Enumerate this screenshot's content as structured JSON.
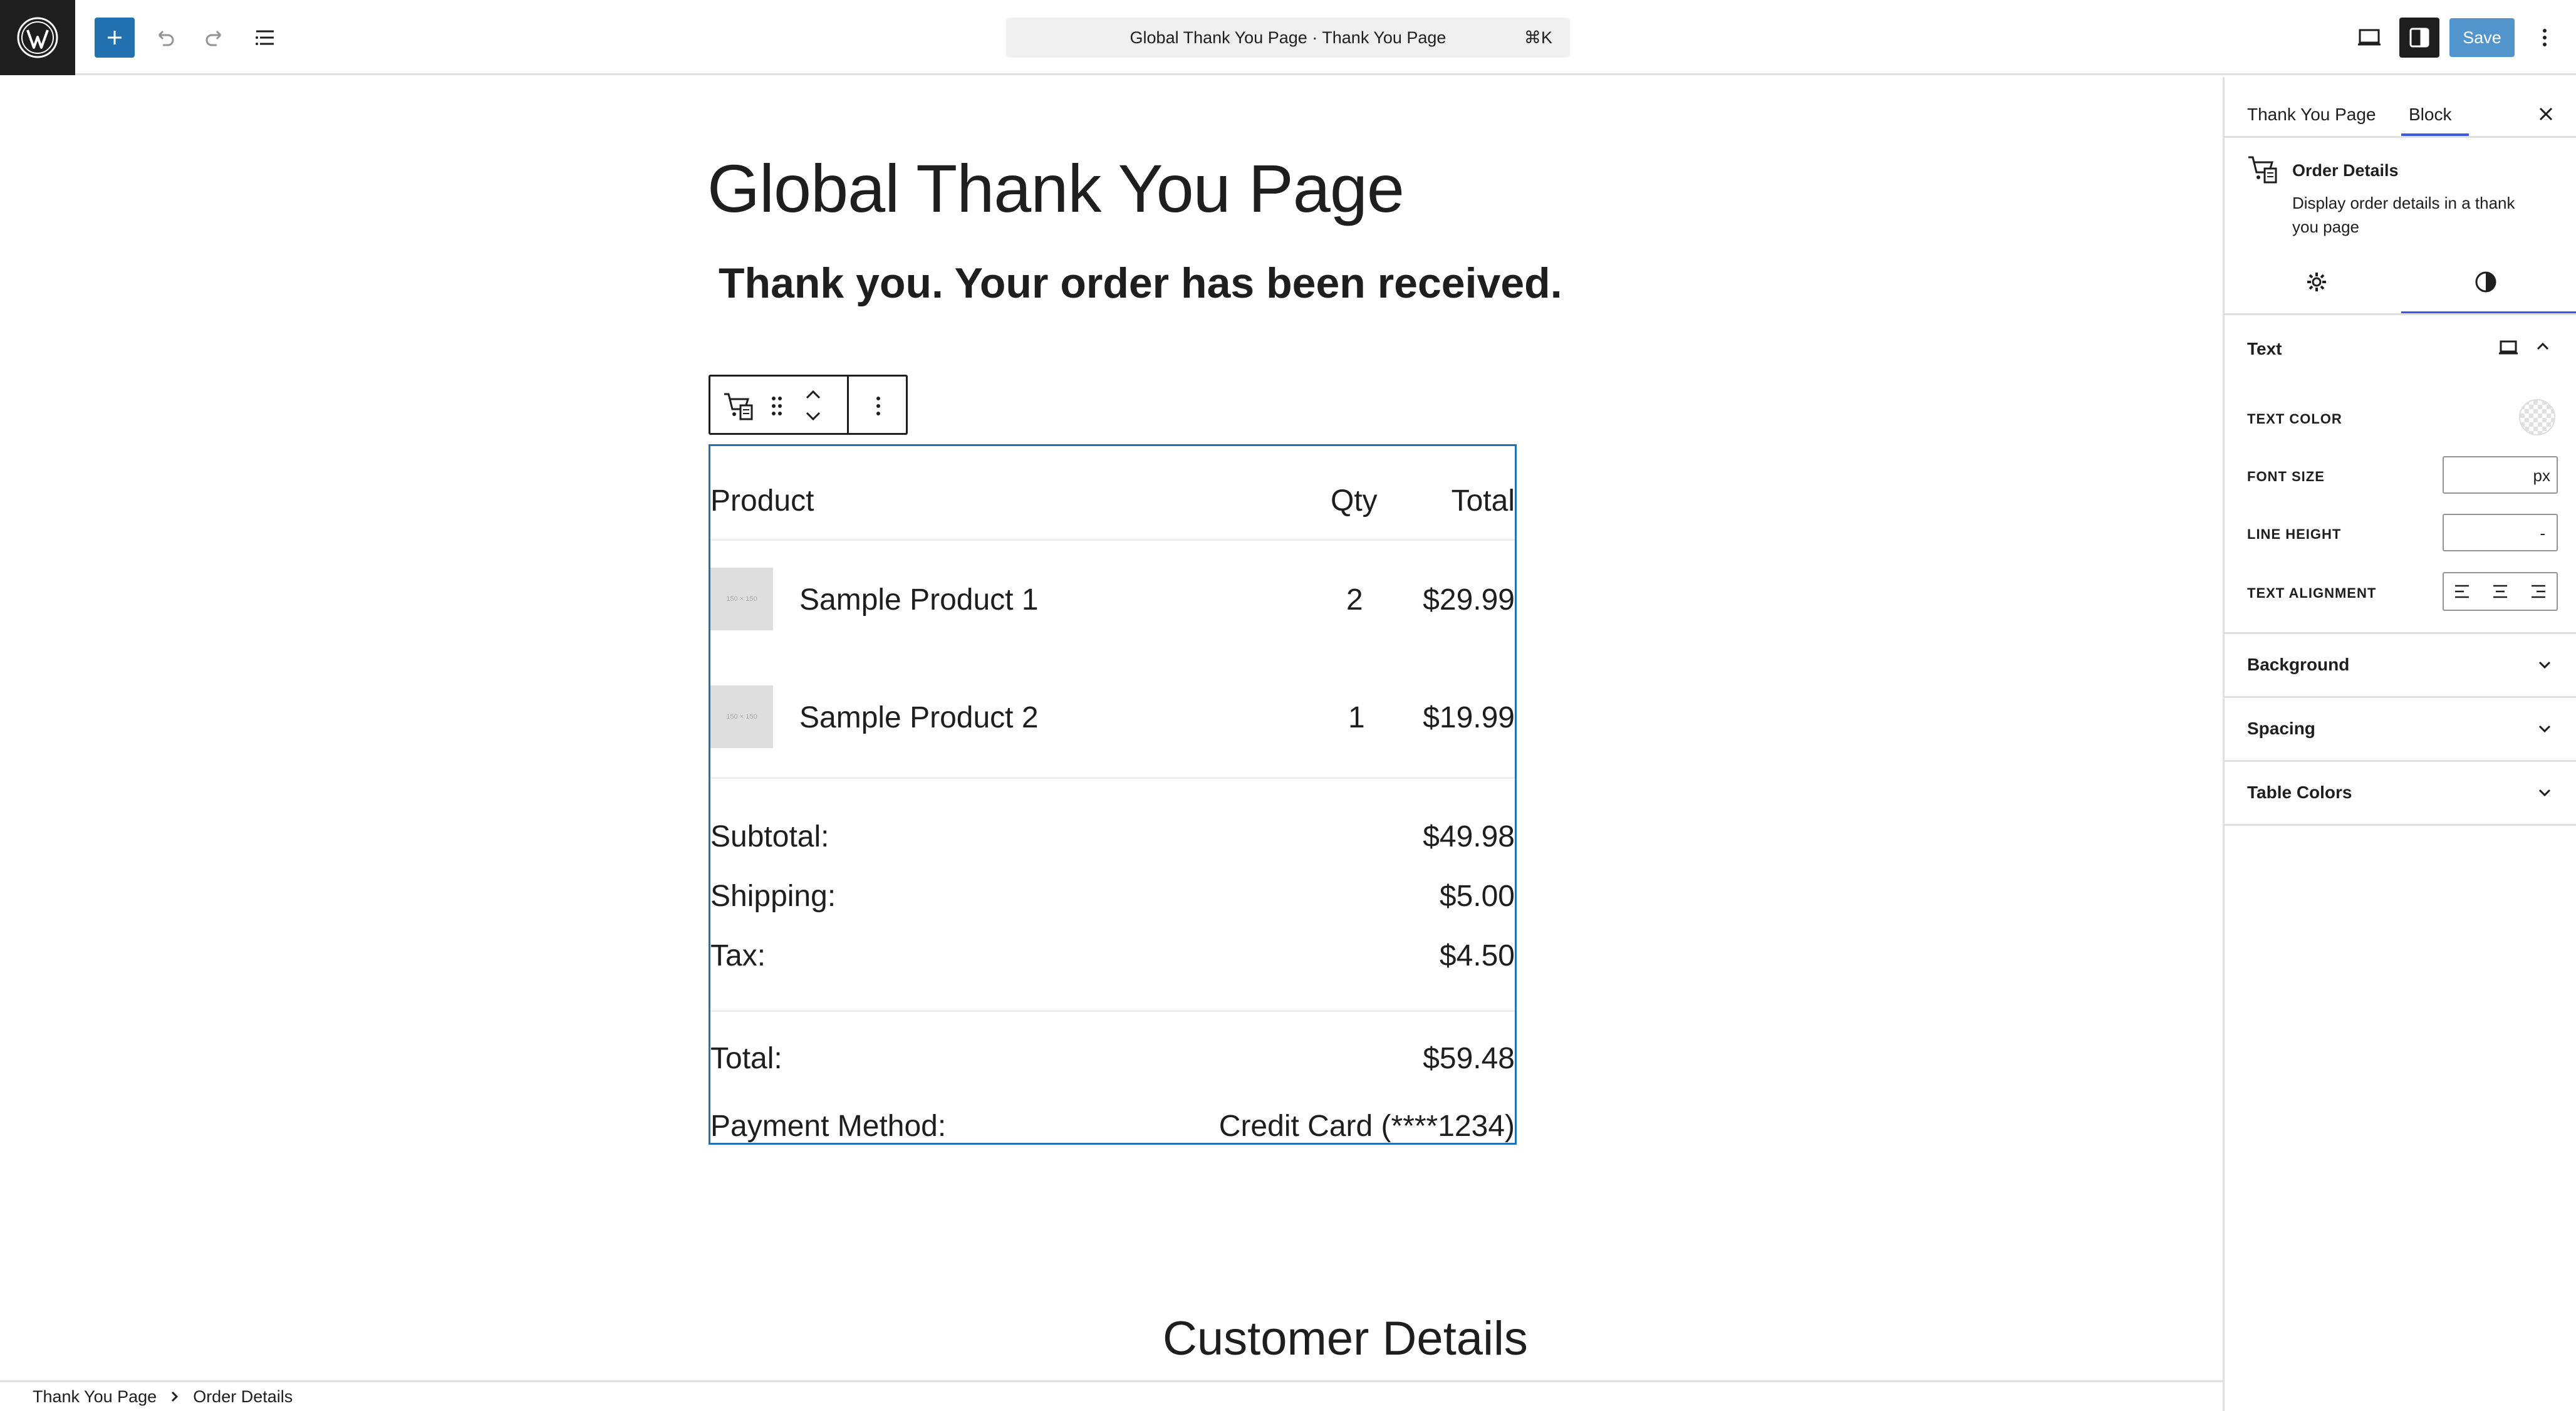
{
  "topbar": {
    "document_title": "Global Thank You Page · Thank You Page",
    "shortcut": "⌘K",
    "save_label": "Save",
    "icons": [
      "wordpress-logo-icon",
      "plus-icon",
      "undo-icon",
      "redo-icon",
      "list-view-icon",
      "desktop-preview-icon",
      "settings-panel-icon",
      "more-options-icon"
    ]
  },
  "canvas": {
    "page_title": "Global Thank You Page",
    "thanks_message": "Thank you. Your order has been received.",
    "order_table": {
      "headers": {
        "product": "Product",
        "qty": "Qty",
        "total": "Total"
      },
      "items": [
        {
          "thumb": "150 × 150",
          "name": "Sample Product 1",
          "qty": "2",
          "total": "$29.99"
        },
        {
          "thumb": "150 × 150",
          "name": "Sample Product 2",
          "qty": "1",
          "total": "$19.99"
        }
      ],
      "subtotal": {
        "label": "Subtotal:",
        "value": "$49.98"
      },
      "shipping": {
        "label": "Shipping:",
        "value": "$5.00"
      },
      "tax": {
        "label": "Tax:",
        "value": "$4.50"
      },
      "total": {
        "label": "Total:",
        "value": "$59.48"
      },
      "payment": {
        "label": "Payment Method:",
        "value": "Credit Card (****1234)"
      }
    },
    "customer_details_heading": "Customer Details"
  },
  "footer": {
    "breadcrumb": [
      "Thank You Page",
      "Order Details"
    ]
  },
  "sidebar": {
    "tabs": [
      {
        "label": "Thank You Page"
      },
      {
        "label": "Block"
      }
    ],
    "active_tab": "Block",
    "block": {
      "title": "Order Details",
      "description": "Display order details in a thank you page"
    },
    "text_panel": {
      "heading": "Text",
      "text_color_label": "TEXT COLOR",
      "font_size_label": "FONT SIZE",
      "font_size_unit": "px",
      "line_height_label": "LINE HEIGHT",
      "line_height_value": "-",
      "text_alignment_label": "TEXT ALIGNMENT"
    },
    "panels": [
      {
        "label": "Background"
      },
      {
        "label": "Spacing"
      },
      {
        "label": "Table Colors"
      }
    ],
    "accent_color": "#3858e9"
  },
  "colors": {
    "wp_blue": "#2271b1",
    "dark": "#1e1e1e",
    "selection_border": "#2271b1"
  }
}
